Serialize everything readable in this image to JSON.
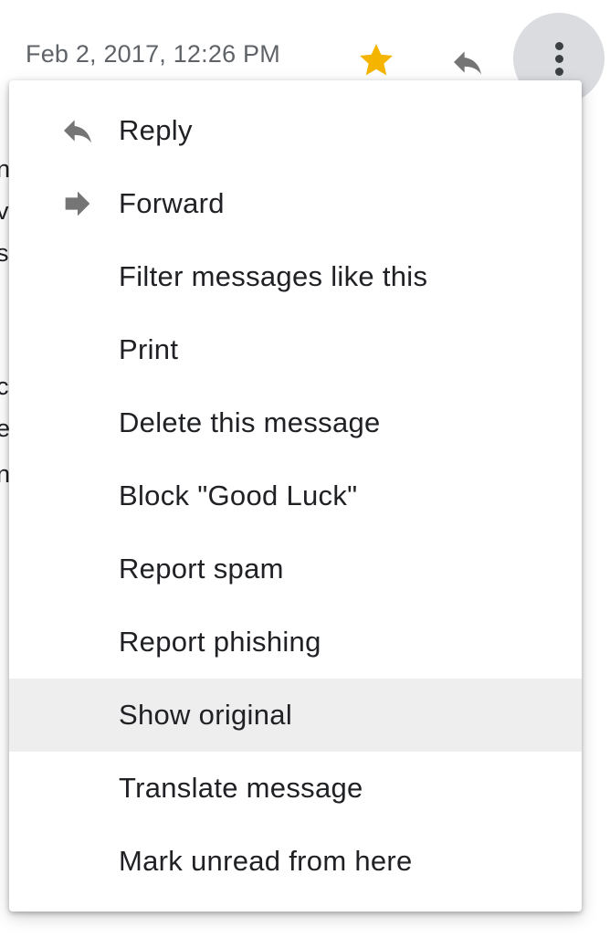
{
  "header": {
    "date": "Feb 2, 2017, 12:26 PM",
    "star_icon": "star-icon",
    "reply_icon": "reply-icon",
    "more_icon": "more-vert-icon"
  },
  "background_text": {
    "fragments": [
      "n",
      "v",
      "s",
      "c",
      "e",
      "n"
    ]
  },
  "menu": {
    "items": [
      {
        "label": "Reply",
        "icon": "reply-icon"
      },
      {
        "label": "Forward",
        "icon": "forward-icon"
      },
      {
        "label": "Filter messages like this"
      },
      {
        "label": "Print"
      },
      {
        "label": "Delete this message"
      },
      {
        "label": "Block \"Good Luck\""
      },
      {
        "label": "Report spam"
      },
      {
        "label": "Report phishing"
      },
      {
        "label": "Show original",
        "highlighted": true
      },
      {
        "label": "Translate message"
      },
      {
        "label": "Mark unread from here"
      }
    ]
  },
  "colors": {
    "star": "#f4b400",
    "icon_gray": "#757575",
    "text": "#202124",
    "muted_text": "#5f6368",
    "hover_bg": "#eeeeee",
    "more_button_bg": "#dadce0"
  }
}
